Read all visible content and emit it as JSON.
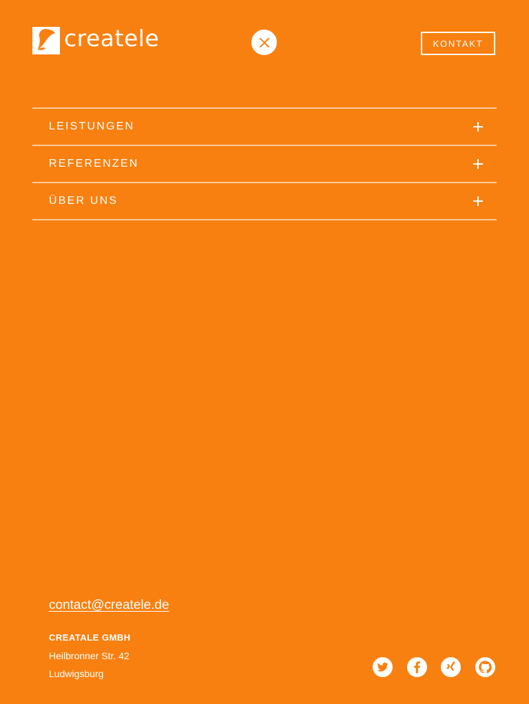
{
  "header": {
    "logo_text": "createle",
    "kontakt_label": "KONTAKT"
  },
  "nav": {
    "items": [
      {
        "label": "LEISTUNGEN"
      },
      {
        "label": "REFERENZEN"
      },
      {
        "label": "ÜBER UNS"
      }
    ]
  },
  "footer": {
    "email": "contact@createle.de",
    "company": "CREATALE GMBH",
    "street": "Heilbronner Str. 42",
    "city": "Ludwigsburg"
  },
  "social": {
    "icons": [
      "twitter-icon",
      "facebook-icon",
      "xing-icon",
      "github-icon"
    ]
  },
  "colors": {
    "background": "#f88010",
    "foreground": "#ffffff"
  }
}
